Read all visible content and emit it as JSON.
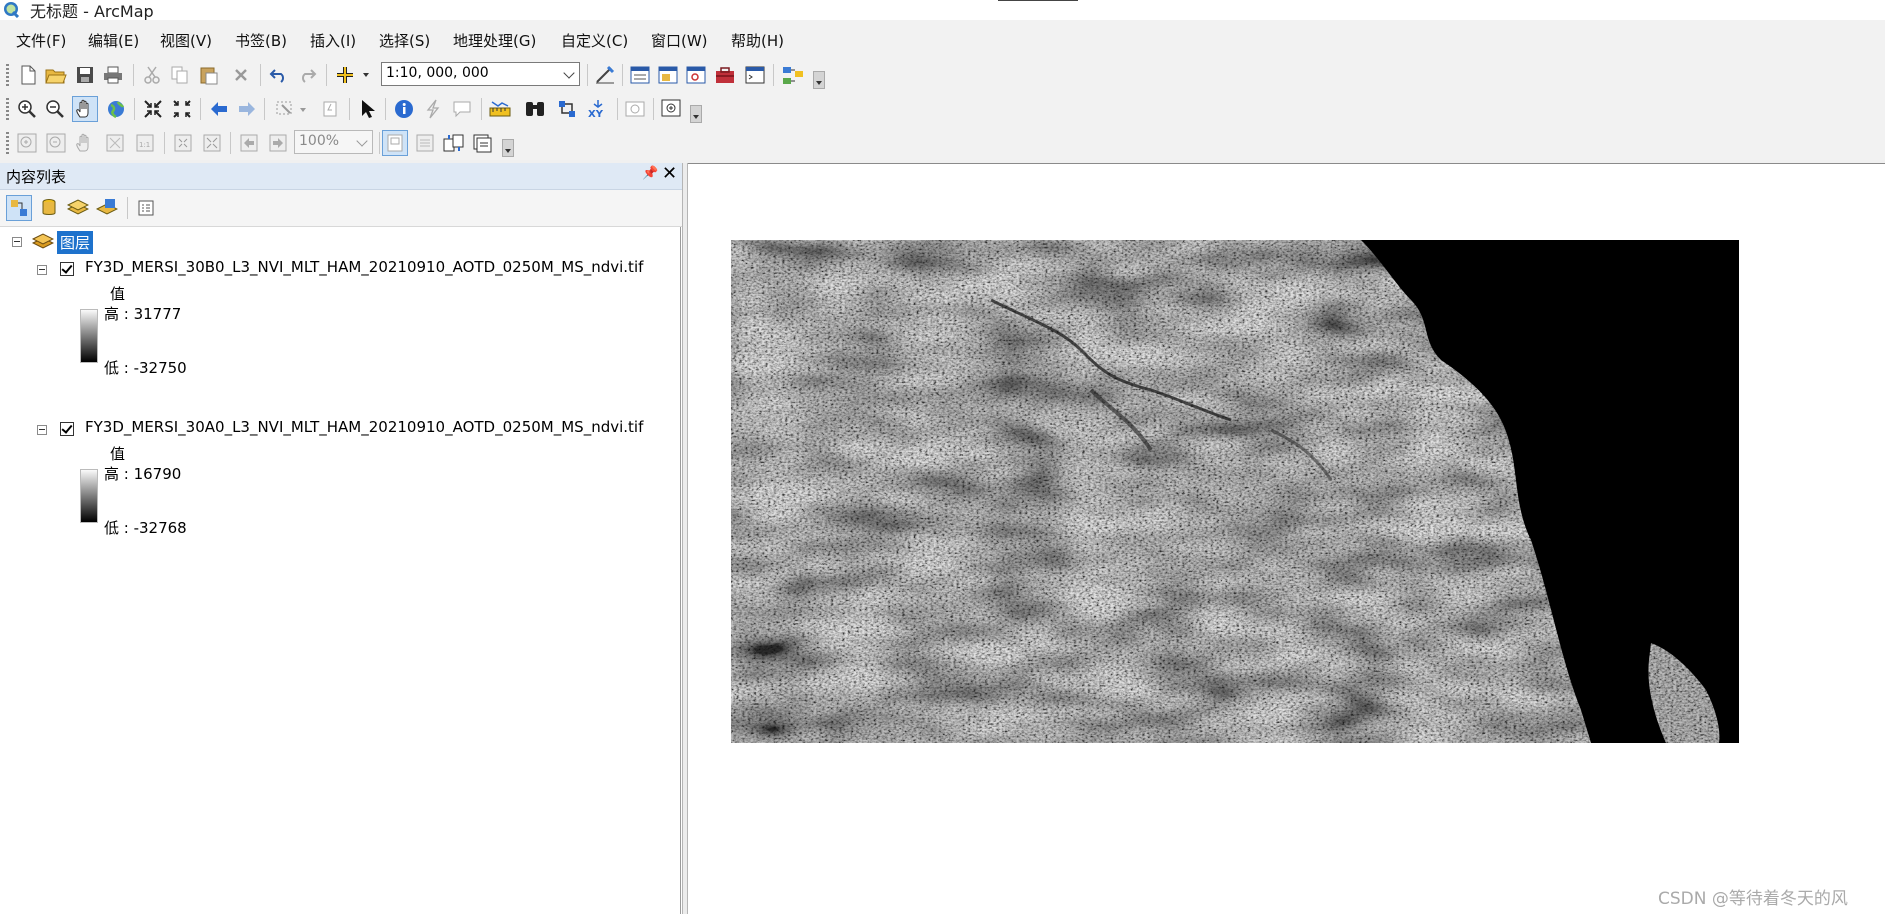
{
  "window": {
    "title": "无标题 - ArcMap"
  },
  "menu": [
    "文件(F)",
    "编辑(E)",
    "视图(V)",
    "书签(B)",
    "插入(I)",
    "选择(S)",
    "地理处理(G)",
    "自定义(C)",
    "窗口(W)",
    "帮助(H)"
  ],
  "toolbar_standard": {
    "scale": "1:10, 000, 000"
  },
  "toolbar_layout": {
    "zoom_percent": "100%"
  },
  "toc": {
    "title": "内容列表",
    "root_label": "图层",
    "layers": [
      {
        "name": "FY3D_MERSI_30B0_L3_NVI_MLT_HAM_20210910_AOTD_0250M_MS_ndvi.tif",
        "value_label": "值",
        "high": "高 : 31777",
        "low": "低 : -32750",
        "checked": true
      },
      {
        "name": "FY3D_MERSI_30A0_L3_NVI_MLT_HAM_20210910_AOTD_0250M_MS_ndvi.tif",
        "value_label": "值",
        "high": "高 : 16790",
        "low": "低 : -32768",
        "checked": true
      }
    ]
  },
  "watermark": "CSDN @等待着冬天的风",
  "colors": {
    "toc_header": "#dfe9f5",
    "selection": "#1e72cc",
    "map_background": "#ffffff",
    "raster_nodata": "#000000"
  },
  "icons": {
    "standard": [
      "new-document-icon",
      "open-folder-icon",
      "save-icon",
      "print-icon",
      "cut-icon",
      "copy-icon",
      "paste-icon",
      "delete-icon",
      "undo-icon",
      "redo-icon",
      "add-data-icon",
      "editor-toolbar-icon",
      "table-of-contents-icon",
      "catalog-icon",
      "search-window-icon",
      "arctoolbox-icon",
      "python-window-icon",
      "model-builder-icon"
    ],
    "tools": [
      "zoom-in-icon",
      "zoom-out-icon",
      "pan-hand-icon",
      "full-extent-globe-icon",
      "fixed-zoom-in-icon",
      "fixed-zoom-out-icon",
      "back-extent-icon",
      "forward-extent-icon",
      "select-features-icon",
      "clear-selection-icon",
      "select-elements-icon",
      "identify-icon",
      "hyperlink-icon",
      "html-popup-icon",
      "measure-icon",
      "find-icon",
      "find-route-icon",
      "go-to-xy-icon",
      "time-slider-icon",
      "create-viewer-window-icon"
    ],
    "layout": [
      "layout-zoom-in-icon",
      "layout-zoom-out-icon",
      "layout-pan-icon",
      "zoom-whole-page-icon",
      "zoom-100-icon",
      "fixed-zoom-in-layout-icon",
      "fixed-zoom-out-layout-icon",
      "previous-extent-icon",
      "next-extent-icon",
      "toggle-draft-mode-icon",
      "focus-data-frame-icon",
      "change-layout-icon",
      "data-driven-pages-icon"
    ],
    "toc": [
      "list-by-drawing-order-icon",
      "list-by-source-icon",
      "list-by-visibility-icon",
      "list-by-selection-icon",
      "toc-options-icon"
    ]
  }
}
